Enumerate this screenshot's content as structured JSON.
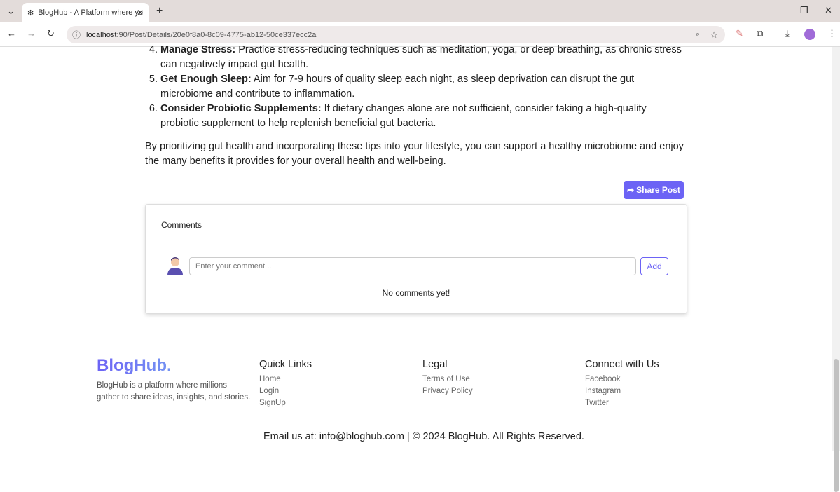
{
  "browser": {
    "tab_title": "BlogHub - A Platform where yo",
    "url_host": "localhost",
    "url_path": ":90/Post/Details/20e0f8a0-8c09-4775-ab12-50ce337ecc2a"
  },
  "article": {
    "items": [
      {
        "num": "4.",
        "title": "Manage Stress:",
        "text": " Practice stress-reducing techniques such as meditation, yoga, or deep breathing, as chronic stress can negatively impact gut health."
      },
      {
        "num": "5.",
        "title": "Get Enough Sleep:",
        "text": " Aim for 7-9 hours of quality sleep each night, as sleep deprivation can disrupt the gut microbiome and contribute to inflammation."
      },
      {
        "num": "6.",
        "title": "Consider Probiotic Supplements:",
        "text": " If dietary changes alone are not sufficient, consider taking a high-quality probiotic supplement to help replenish beneficial gut bacteria."
      }
    ],
    "conclusion": "By prioritizing gut health and incorporating these tips into your lifestyle, you can support a healthy microbiome and enjoy the many benefits it provides for your overall health and well-being.",
    "share_label": "Share Post"
  },
  "comments": {
    "title": "Comments",
    "placeholder": "Enter your comment...",
    "add_label": "Add",
    "empty": "No comments yet!"
  },
  "footer": {
    "logo": "BlogHub.",
    "description": "BlogHub is a platform where millions gather to share ideas, insights, and stories.",
    "quick_links": {
      "title": "Quick Links",
      "links": [
        "Home",
        "Login",
        "SignUp"
      ]
    },
    "legal": {
      "title": "Legal",
      "links": [
        "Terms of Use",
        "Privacy Policy"
      ]
    },
    "connect": {
      "title": "Connect with Us",
      "links": [
        "Facebook",
        "Instagram",
        "Twitter"
      ]
    },
    "bottom": "Email us at: info@bloghub.com |  © 2024 BlogHub. All Rights Reserved."
  },
  "colors": {
    "accent": "#6c63f5"
  }
}
